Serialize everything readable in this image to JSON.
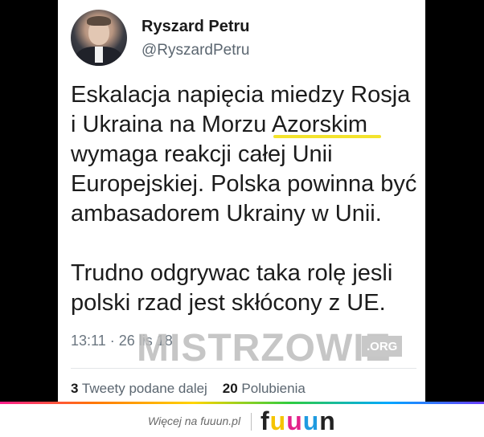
{
  "tweet": {
    "display_name": "Ryszard Petru",
    "handle": "@RyszardPetru",
    "text": "Eskalacja napięcia miedzy Rosja\ni Ukraina na Morzu Azorskim\nwymaga reakcji całej Unii\nEuropejskiej. Polska powinna być\nambasadorem Ukrainy w Unii.\n\nTrudno odgrywac taka rolę jesli\npolski rzad jest skłócony z UE.",
    "timestamp": "13:11 · 26 lis 18",
    "retweets_count": "3",
    "retweets_label": "Tweety podane dalej",
    "likes_count": "20",
    "likes_label": "Polubienia"
  },
  "watermark": {
    "text": "MISTRZOWIE",
    "tag": ".ORG"
  },
  "footer": {
    "more_text": "Więcej na fuuun.pl",
    "logo_letters": [
      "f",
      "u",
      "u",
      "u",
      "n"
    ],
    "logo_colors": [
      "#222222",
      "#f5c400",
      "#e3218a",
      "#1f9be0",
      "#222222"
    ]
  }
}
